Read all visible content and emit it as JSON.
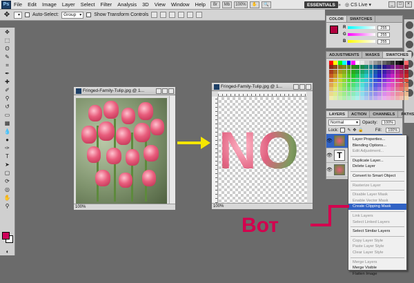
{
  "menubar": {
    "logo": "Ps",
    "items": [
      "File",
      "Edit",
      "Image",
      "Layer",
      "Select",
      "Filter",
      "Analysis",
      "3D",
      "View",
      "Window",
      "Help"
    ],
    "zoom": "100%",
    "workspace": "ESSENTIALS",
    "cslive": "CS Live"
  },
  "options": {
    "auto_select_label": "Auto-Select:",
    "auto_select_value": "Group",
    "transform_label": "Show Transform Controls"
  },
  "doc_left": {
    "title": "Fringed-Family-Tulip.jpg @ 1...",
    "zoom": "100%"
  },
  "doc_right": {
    "title": "Fringed-Family-Tulip.jpg @ 1...",
    "zoom": "100%",
    "text_art": "NO"
  },
  "color_panel": {
    "tabs": [
      "COLOR",
      "SWATCHES"
    ],
    "r": "255",
    "g": "255",
    "b": "255",
    "fg_color": "#b2003f"
  },
  "adjustments_panel": {
    "tabs": [
      "ADJUSTMENTS",
      "MASKS",
      "SWATCHES"
    ]
  },
  "layers_panel": {
    "tabs": [
      "LAYERS",
      "ACTION",
      "CHANNELS",
      "PATHS"
    ],
    "blend_mode": "Normal",
    "opacity_label": "Opacity:",
    "opacity": "100%",
    "lock_label": "Lock:",
    "fill_label": "Fill:",
    "fill": "100%"
  },
  "context_menu": [
    {
      "label": "Layer Properties...",
      "disabled": false
    },
    {
      "label": "Blending Options...",
      "disabled": false
    },
    {
      "label": "Edit Adjustment...",
      "disabled": true
    },
    {
      "sep": true
    },
    {
      "label": "Duplicate Layer...",
      "disabled": false
    },
    {
      "label": "Delete Layer",
      "disabled": false
    },
    {
      "sep": true
    },
    {
      "label": "Convert to Smart Object",
      "disabled": false
    },
    {
      "sep": true
    },
    {
      "label": "Rasterize Layer",
      "disabled": true
    },
    {
      "sep": true
    },
    {
      "label": "Disable Layer Mask",
      "disabled": true
    },
    {
      "label": "Enable Vector Mask",
      "disabled": true
    },
    {
      "label": "Create Clipping Mask",
      "disabled": false,
      "highlight": true
    },
    {
      "sep": true
    },
    {
      "label": "Link Layers",
      "disabled": true
    },
    {
      "label": "Select Linked Layers",
      "disabled": true
    },
    {
      "sep": true
    },
    {
      "label": "Select Similar Layers",
      "disabled": false
    },
    {
      "sep": true
    },
    {
      "label": "Copy Layer Style",
      "disabled": true
    },
    {
      "label": "Paste Layer Style",
      "disabled": true
    },
    {
      "label": "Clear Layer Style",
      "disabled": true
    },
    {
      "sep": true
    },
    {
      "label": "Merge Layers",
      "disabled": true
    },
    {
      "label": "Merge Visible",
      "disabled": false
    },
    {
      "label": "Flatten Image",
      "disabled": false
    }
  ],
  "annotation": {
    "label": "Вот",
    "color": "#d3004e",
    "arrow_color": "#f5e600"
  }
}
